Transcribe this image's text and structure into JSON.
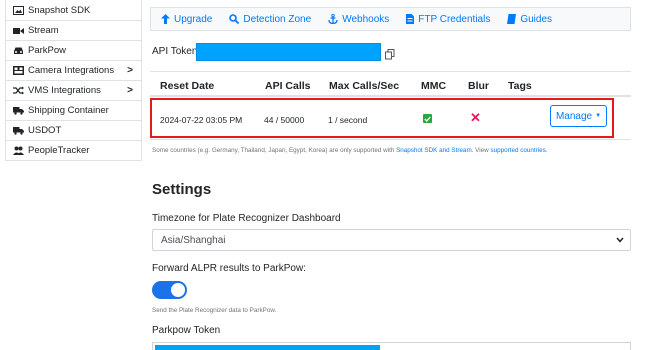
{
  "sidebar": {
    "items": [
      {
        "label": "Snapshot SDK",
        "icon": "image-icon",
        "chevron": false
      },
      {
        "label": "Stream",
        "icon": "video-icon",
        "chevron": false
      },
      {
        "label": "ParkPow",
        "icon": "car-icon",
        "chevron": false
      },
      {
        "label": "Camera Integrations",
        "icon": "camera-grid-icon",
        "chevron": true
      },
      {
        "label": "VMS Integrations",
        "icon": "shuffle-icon",
        "chevron": true
      },
      {
        "label": "Shipping Container",
        "icon": "truck-icon",
        "chevron": false
      },
      {
        "label": "USDOT",
        "icon": "truck-icon",
        "chevron": false
      },
      {
        "label": "PeopleTracker",
        "icon": "people-icon",
        "chevron": false
      }
    ],
    "chevron_glyph": ">"
  },
  "topnav": {
    "links": [
      {
        "label": "Upgrade",
        "icon": "arrow-up-icon"
      },
      {
        "label": "Detection Zone",
        "icon": "search-icon"
      },
      {
        "label": "Webhooks",
        "icon": "anchor-icon"
      },
      {
        "label": "FTP Credentials",
        "icon": "file-icon"
      },
      {
        "label": "Guides",
        "icon": "book-icon"
      }
    ]
  },
  "api_token": {
    "label": "API Token:",
    "value_hidden": true
  },
  "table": {
    "headers": [
      "Reset Date",
      "API Calls",
      "Max Calls/Sec",
      "MMC",
      "Blur",
      "Tags"
    ],
    "row": {
      "reset_date": "2024-07-22 03:05 PM",
      "api_calls": "44 / 50000",
      "max_calls": "1 / second",
      "mmc": true,
      "blur": false,
      "tags": "",
      "manage_label": "Manage",
      "blur_glyph": "✕"
    }
  },
  "note": {
    "prefix": "Some countries (e.g. Germany, Thailand, Japan, Egypt, Korea) are only supported with ",
    "link1": "Snapshot SDK and Stream",
    "middle": ". View ",
    "link2": "supported countries",
    "suffix": "."
  },
  "settings": {
    "title": "Settings",
    "timezone_label": "Timezone for Plate Recognizer Dashboard",
    "timezone_value": "Asia/Shanghai",
    "forward_label": "Forward ALPR results to ParkPow:",
    "forward_enabled": true,
    "send_note": "Send the Plate Recognizer data to ParkPow.",
    "parkpow_token_label": "Parkpow Token"
  },
  "colors": {
    "accent": "#007bff",
    "highlight_border": "#e21a1a",
    "check_green": "#28a745",
    "x_red": "#e8195d",
    "token_mask": "#00a2ff"
  }
}
